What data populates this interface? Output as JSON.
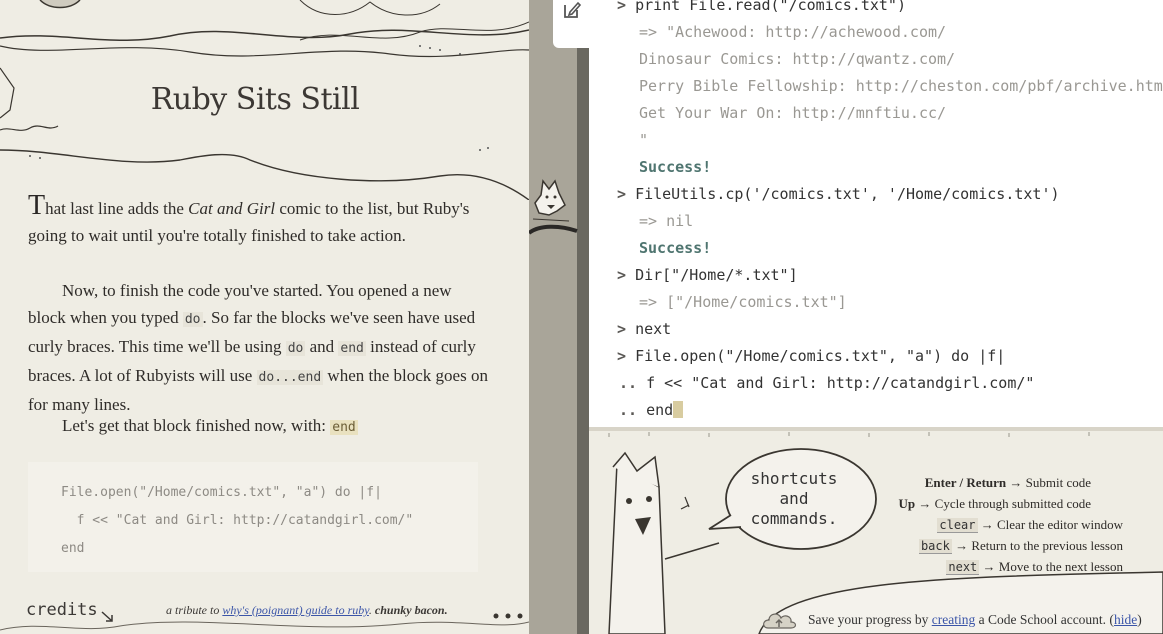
{
  "lesson": {
    "title": "Ruby Sits Still",
    "p1_dropcap": "T",
    "p1_a": "hat last line adds the ",
    "p1_em": "Cat and Girl",
    "p1_b": " comic to the list, but Ruby's going to wait until you're totally finished to take action.",
    "p2_a": "Now, to finish the code you've started. You opened a new block when you typed ",
    "p2_code1": "do",
    "p2_b": ". So far the blocks we've seen have used curly braces. This time we'll be using ",
    "p2_code2": "do",
    "p2_c": " and ",
    "p2_code3": "end",
    "p2_d": " instead of curly braces. A lot of Rubyists will use ",
    "p2_code4": "do...end",
    "p2_e": " when the block goes on for many lines.",
    "p3_a": "Let's get that block finished now, with: ",
    "p3_code": "end",
    "code_sample": [
      "File.open(\"/Home/comics.txt\", \"a\") do |f|",
      "  f << \"Cat and Girl: http://catandgirl.com/\"",
      "end"
    ],
    "credits": "credits",
    "tribute_prefix": "a tribute to ",
    "tribute_link": "why's (poignant) guide to ruby",
    "tribute_mid": ". ",
    "tribute_bold": "chunky bacon."
  },
  "console": {
    "lines": [
      {
        "prompt": "> ",
        "text": "print File.read(\"/comics.txt\")",
        "kind": "input"
      },
      {
        "prompt": "  ",
        "text": "=> \"Achewood: http://achewood.com/",
        "kind": "output"
      },
      {
        "prompt": "  ",
        "text": "Dinosaur Comics: http://qwantz.com/",
        "kind": "output"
      },
      {
        "prompt": "  ",
        "text": "Perry Bible Fellowship: http://cheston.com/pbf/archive.html",
        "kind": "output"
      },
      {
        "prompt": "  ",
        "text": "Get Your War On: http://mnftiu.cc/",
        "kind": "output"
      },
      {
        "prompt": "  ",
        "text": "\"",
        "kind": "output"
      },
      {
        "prompt": "  ",
        "text": "Success!",
        "kind": "success"
      },
      {
        "prompt": "> ",
        "text": "FileUtils.cp('/comics.txt', '/Home/comics.txt')",
        "kind": "input"
      },
      {
        "prompt": "  ",
        "text": "=> nil",
        "kind": "output"
      },
      {
        "prompt": "  ",
        "text": "Success!",
        "kind": "success"
      },
      {
        "prompt": "> ",
        "text": "Dir[\"/Home/*.txt\"]",
        "kind": "input"
      },
      {
        "prompt": "  ",
        "text": "=> [\"/Home/comics.txt\"]",
        "kind": "output"
      },
      {
        "prompt": "> ",
        "text": "next",
        "kind": "input"
      },
      {
        "prompt": "> ",
        "text": "File.open(\"/Home/comics.txt\", \"a\") do |f|",
        "kind": "input"
      },
      {
        "prompt": ".. ",
        "text": "f << \"Cat and Girl: http://catandgirl.com/\"",
        "kind": "input"
      },
      {
        "prompt": ".. ",
        "text": "end",
        "kind": "input"
      }
    ]
  },
  "shortcuts": {
    "bubble": "shortcuts and commands.",
    "rows": [
      {
        "key": "Enter / Return",
        "desc": " → Submit code",
        "style": "bold"
      },
      {
        "key": "Up",
        "desc": " → Cycle through submitted code",
        "style": "bold"
      },
      {
        "key": "clear",
        "desc": " → Clear the editor window",
        "style": "code"
      },
      {
        "key": "back",
        "desc": " → Return to the previous lesson",
        "style": "code"
      },
      {
        "key": "next",
        "desc": " → Move to the next lesson",
        "style": "code"
      }
    ]
  },
  "save": {
    "prefix": "Save your progress by ",
    "link": "creating",
    "middle": " a Code School account. (",
    "hide": "hide",
    "suffix": ")"
  },
  "icons": {
    "edit": "edit-pencil-icon",
    "save": "cloud-upload-icon"
  }
}
